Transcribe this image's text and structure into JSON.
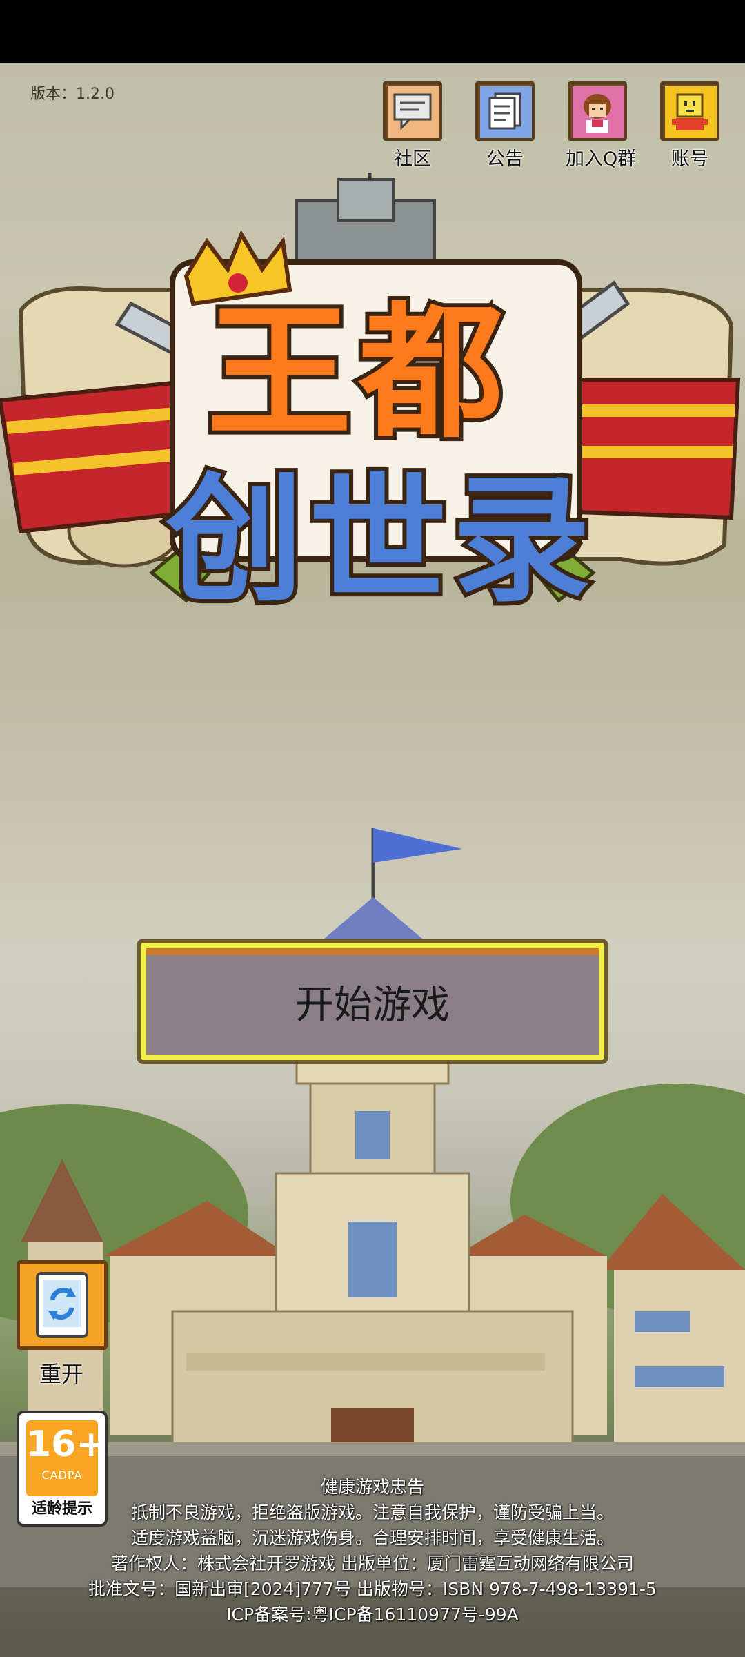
{
  "version": "版本：1.2.0",
  "top_buttons": [
    {
      "label": "社区",
      "icon": "chat-bubble-icon"
    },
    {
      "label": "公告",
      "icon": "document-icon"
    },
    {
      "label": "加入Q群",
      "icon": "character-portrait-icon"
    },
    {
      "label": "账号",
      "icon": "smiley-icon"
    }
  ],
  "logo": {
    "line1": "王都",
    "line2": "创世录"
  },
  "start_button": "开始游戏",
  "restart_button": "重开",
  "age_rating": {
    "number": "16+",
    "org": "CADPA",
    "tip": "适龄提示"
  },
  "notice": [
    "健康游戏忠告",
    "抵制不良游戏，拒绝盗版游戏。注意自我保护，谨防受骗上当。",
    "适度游戏益脑，沉迷游戏伤身。合理安排时间，享受健康生活。",
    "著作权人：株式会社开罗游戏  出版单位：厦门雷霆互动网络有限公司",
    "批准文号：国新出审[2024]777号 出版物号：ISBN 978-7-498-13391-5",
    "ICP备案号:粤ICP备16110977号-99A"
  ],
  "colors": {
    "start_border": "#f2ee4c",
    "age_badge": "#f7a523"
  }
}
